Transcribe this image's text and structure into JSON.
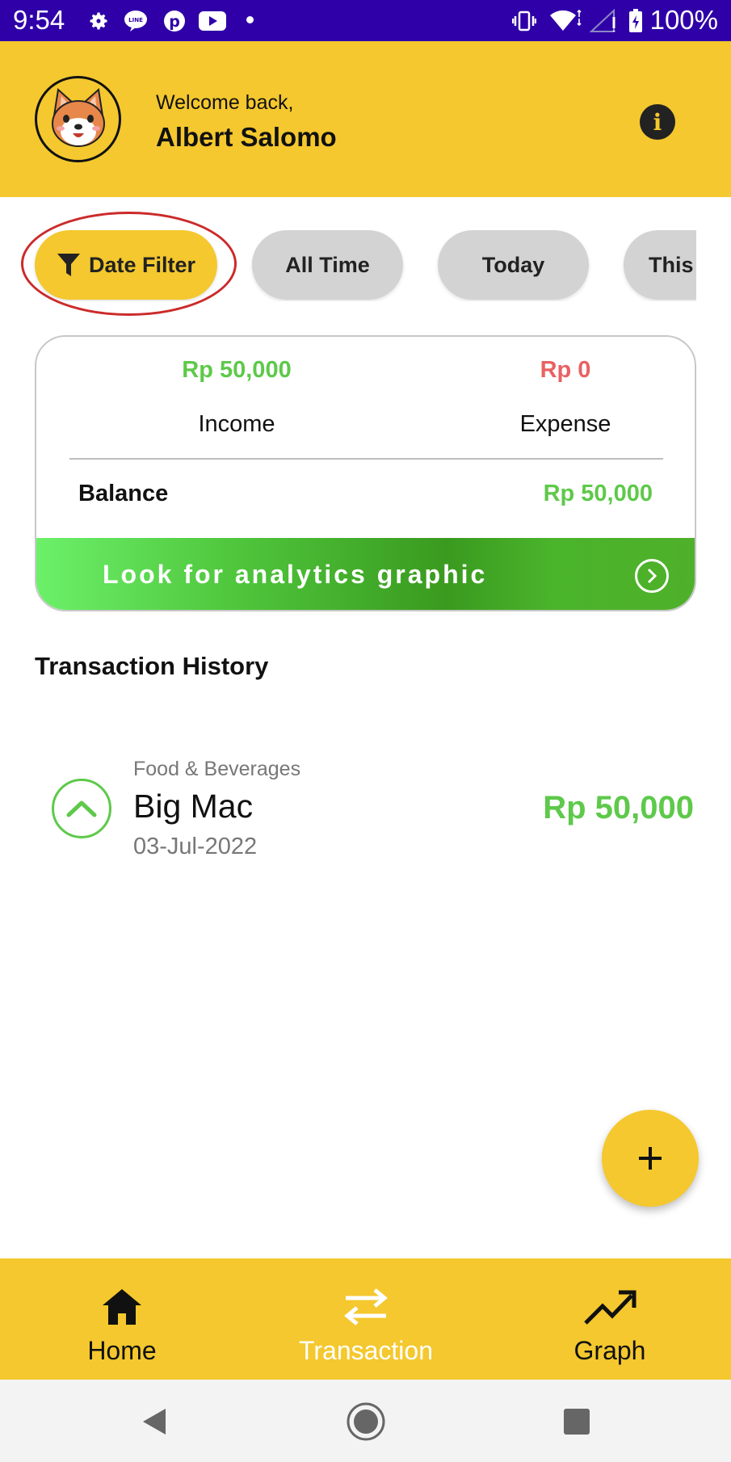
{
  "status_bar": {
    "time": "9:54",
    "battery": "100%",
    "icons": [
      "settings-icon",
      "line-icon",
      "pinterest-icon",
      "youtube-icon",
      "dot-icon",
      "vibrate-icon",
      "wifi-icon",
      "signal-icon",
      "battery-icon"
    ]
  },
  "header": {
    "welcome": "Welcome back,",
    "username": "Albert Salomo",
    "info_icon": "info-icon"
  },
  "filters": {
    "date_filter": "Date Filter",
    "all_time": "All Time",
    "today": "Today",
    "this_partial": "This"
  },
  "summary": {
    "income_amount": "Rp 50,000",
    "income_label": "Income",
    "expense_amount": "Rp 0",
    "expense_label": "Expense",
    "balance_label": "Balance",
    "balance_value": "Rp 50,000",
    "analytics_label": "Look for analytics graphic"
  },
  "history": {
    "title": "Transaction History",
    "items": [
      {
        "category": "Food & Beverages",
        "name": "Big Mac",
        "date": "03-Jul-2022",
        "amount": "Rp 50,000"
      }
    ]
  },
  "fab": {
    "label": "+"
  },
  "bottom_nav": {
    "home": "Home",
    "transaction": "Transaction",
    "graph": "Graph",
    "active": "Transaction"
  },
  "colors": {
    "status_bar": "#2f00a8",
    "accent": "#f4c82e",
    "income": "#5ec94a",
    "expense": "#e86262",
    "annotation": "#cc2a2a"
  }
}
